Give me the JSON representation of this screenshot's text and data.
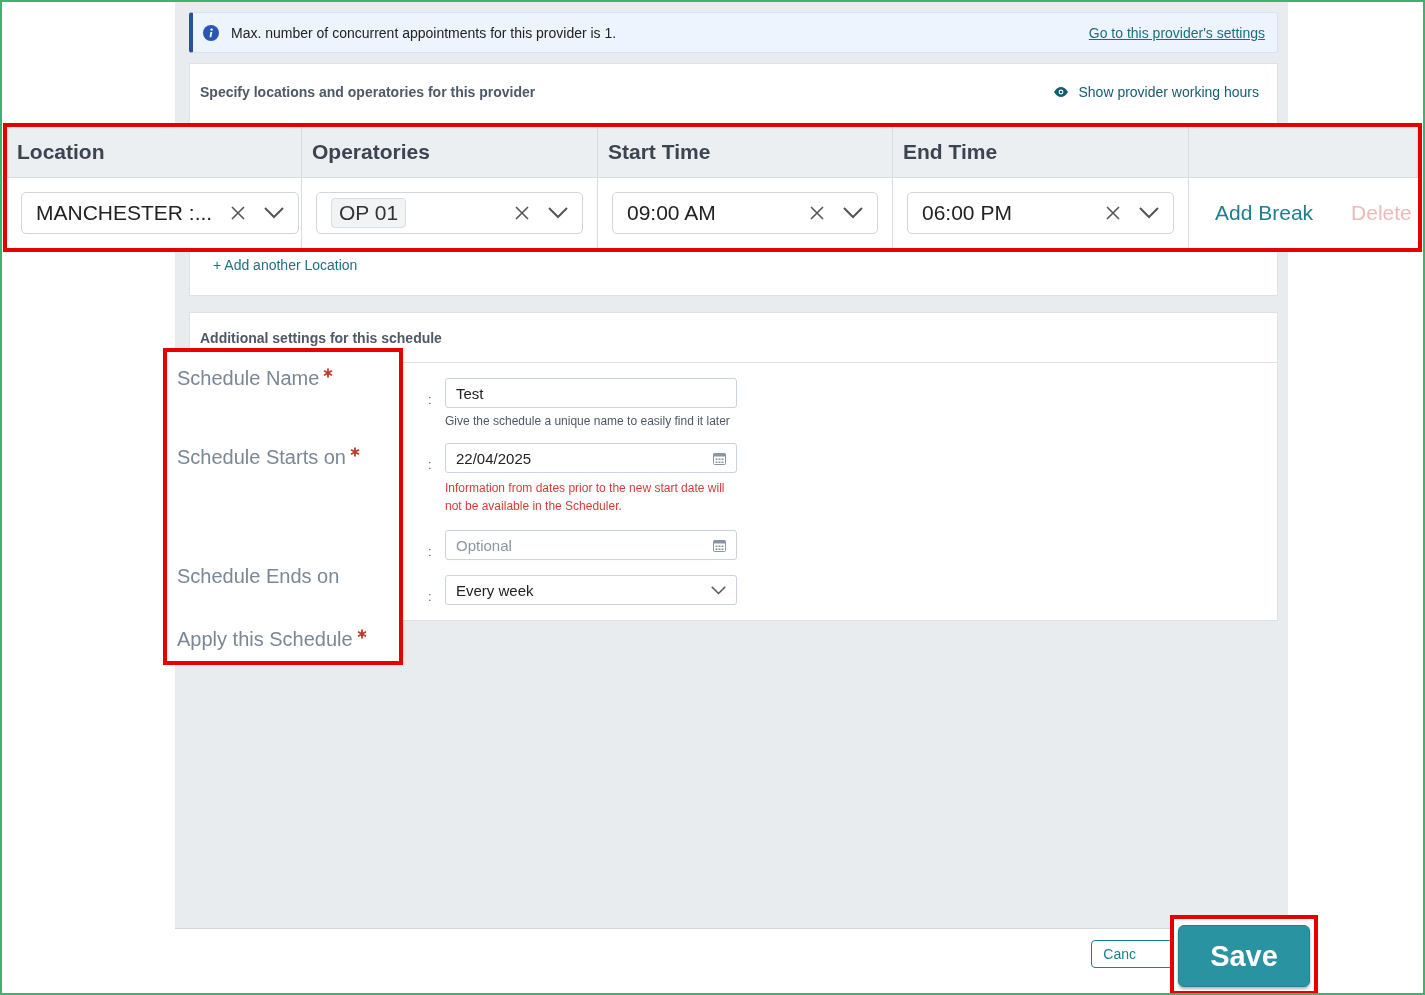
{
  "banner": {
    "message": "Max. number of concurrent appointments for this provider is 1.",
    "link": "Go to this provider's settings"
  },
  "locations": {
    "title": "Specify locations and operatories for this provider",
    "toggle": "Show provider working hours",
    "add_link": "+ Add another Location"
  },
  "schedule_table": {
    "columns": [
      "Location",
      "Operatories",
      "Start Time",
      "End Time"
    ],
    "rows": [
      {
        "cells": [
          {
            "kind": "select",
            "value": "MANCHESTER :..."
          },
          {
            "kind": "tag",
            "value": "OP 01"
          },
          {
            "kind": "select",
            "value": "09:00 AM"
          },
          {
            "kind": "select",
            "value": "06:00 PM"
          }
        ],
        "actions": [
          {
            "label": "Add Break",
            "disabled": false
          },
          {
            "label": "Delete",
            "disabled": true
          }
        ]
      }
    ]
  },
  "settings": {
    "title": "Additional settings for this schedule",
    "labels": [
      {
        "text": "Schedule Name",
        "required": true
      },
      {
        "text": "Schedule Starts on",
        "required": true
      },
      {
        "text": "Schedule Ends on",
        "required": false
      },
      {
        "text": "Apply this Schedule",
        "required": true
      }
    ],
    "fields": [
      {
        "kind": "text",
        "separator": ":",
        "value": "Test",
        "hint": "Give the schedule a unique name to easily find it later"
      },
      {
        "kind": "date",
        "separator": ":",
        "value": "22/04/2025",
        "warning": "Information from dates prior to the new start date will not be available in the Scheduler."
      },
      {
        "kind": "date",
        "separator": ":",
        "placeholder": "Optional"
      },
      {
        "kind": "select",
        "separator": ":",
        "value": "Every week"
      }
    ]
  },
  "footer": {
    "cancel": "Canc",
    "save": "Save"
  }
}
